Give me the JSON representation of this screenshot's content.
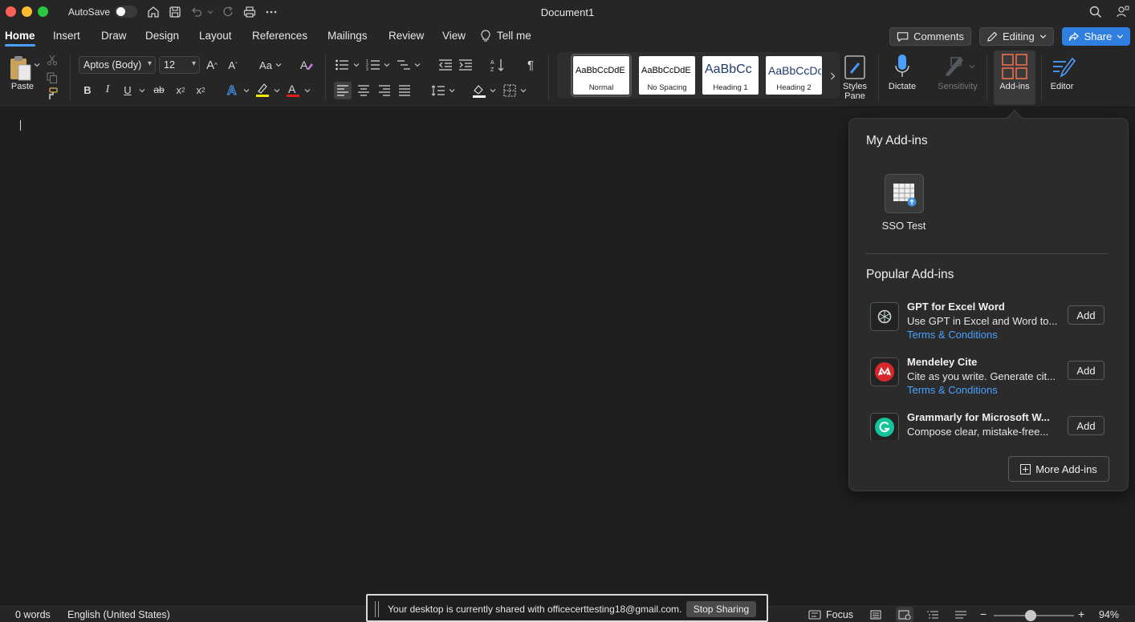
{
  "titlebar": {
    "autosave_label": "AutoSave",
    "document_title": "Document1"
  },
  "tabs": [
    {
      "label": "Home"
    },
    {
      "label": "Insert"
    },
    {
      "label": "Draw"
    },
    {
      "label": "Design"
    },
    {
      "label": "Layout"
    },
    {
      "label": "References"
    },
    {
      "label": "Mailings"
    },
    {
      "label": "Review"
    },
    {
      "label": "View"
    },
    {
      "label": "Tell me"
    }
  ],
  "actions": {
    "comments_label": "Comments",
    "editing_label": "Editing",
    "share_label": "Share"
  },
  "ribbon": {
    "paste_label": "Paste",
    "font_name": "Aptos (Body)",
    "font_size": "12",
    "change_case_label": "Aa",
    "styles": [
      {
        "sample": "AaBbCcDdE",
        "name": "Normal"
      },
      {
        "sample": "AaBbCcDdE",
        "name": "No Spacing"
      },
      {
        "sample": "AaBbCc",
        "name": "Heading 1"
      },
      {
        "sample": "AaBbCcDc",
        "name": "Heading 2"
      }
    ],
    "styles_pane_label": "Styles Pane",
    "dictate_label": "Dictate",
    "sensitivity_label": "Sensitivity",
    "addins_label": "Add-ins",
    "editor_label": "Editor",
    "bold": "B",
    "italic": "I",
    "underline": "U",
    "strike": "ab",
    "subscript": "x",
    "superscript": "x"
  },
  "addins_panel": {
    "my_addins_heading": "My Add-ins",
    "my_addins": [
      {
        "name": "SSO Test"
      }
    ],
    "popular_heading": "Popular Add-ins",
    "popular": [
      {
        "title": "GPT for Excel Word",
        "description": "Use GPT in Excel and Word to...",
        "link": "Terms & Conditions",
        "button": "Add"
      },
      {
        "title": "Mendeley Cite",
        "description": "Cite as you write. Generate cit...",
        "link": "Terms & Conditions",
        "button": "Add"
      },
      {
        "title": "Grammarly for Microsoft W...",
        "description": "Compose clear, mistake-free...",
        "link": "",
        "button": "Add"
      }
    ],
    "more_button": "More Add-ins"
  },
  "statusbar": {
    "word_count": "0 words",
    "language": "English (United States)",
    "focus_label": "Focus",
    "zoom": "94%"
  },
  "sharing_banner": {
    "message": "Your desktop is currently shared with officecerttesting18@gmail.com.",
    "stop_button": "Stop Sharing"
  },
  "colors": {
    "accent_blue": "#2f7fe0",
    "link_blue": "#4aa0ff",
    "background": "#1f1f1f",
    "highlight_yellow": "#f5e800",
    "font_red": "#e02020"
  }
}
